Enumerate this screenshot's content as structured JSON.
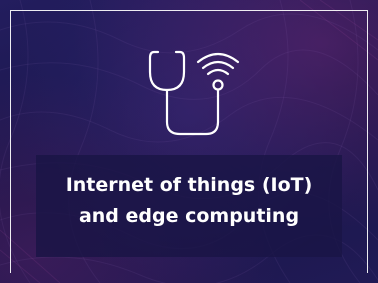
{
  "tile": {
    "icon": "stethoscope-wireless-icon",
    "title_line1": "Internet of things (IoT)",
    "title_line2": "and edge computing"
  },
  "colors": {
    "background": "#1b1850",
    "accent_purple": "#7a2a7a",
    "text": "#ffffff",
    "frame": "#ffffff"
  }
}
